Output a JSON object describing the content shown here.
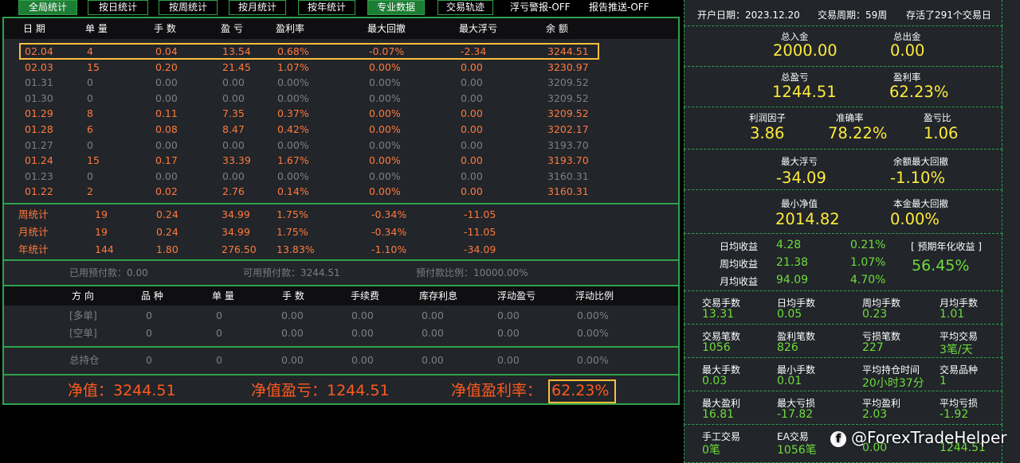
{
  "tabs": [
    {
      "label": "全局统计",
      "active": true
    },
    {
      "label": "按日统计",
      "active": false
    },
    {
      "label": "按周统计",
      "active": false
    },
    {
      "label": "按月统计",
      "active": false
    },
    {
      "label": "按年统计",
      "active": false
    },
    {
      "label": "专业数据",
      "active": true
    },
    {
      "label": "交易轨迹",
      "active": false
    }
  ],
  "flags": {
    "float_alert": "浮亏警报-OFF",
    "report_push": "报告推送-OFF"
  },
  "daily": {
    "headers": [
      "日 期",
      "单 量",
      "手 数",
      "盈 亏",
      "盈利率",
      "最大回撤",
      "最大浮亏",
      "余 额"
    ],
    "rows": [
      {
        "date": "02.04",
        "count": "4",
        "lots": "0.04",
        "pnl": "13.54",
        "rate": "0.68%",
        "maxdd": "-0.07%",
        "maxfloat": "-2.34",
        "balance": "3244.51",
        "style": "o"
      },
      {
        "date": "02.03",
        "count": "15",
        "lots": "0.20",
        "pnl": "21.45",
        "rate": "1.07%",
        "maxdd": "0.00%",
        "maxfloat": "0.00",
        "balance": "3230.97",
        "style": "o"
      },
      {
        "date": "01.31",
        "count": "0",
        "lots": "0.00",
        "pnl": "0.00",
        "rate": "0.00%",
        "maxdd": "0.00%",
        "maxfloat": "0.00",
        "balance": "3209.52",
        "style": "g"
      },
      {
        "date": "01.30",
        "count": "0",
        "lots": "0.00",
        "pnl": "0.00",
        "rate": "0.00%",
        "maxdd": "0.00%",
        "maxfloat": "0.00",
        "balance": "3209.52",
        "style": "g"
      },
      {
        "date": "01.29",
        "count": "8",
        "lots": "0.11",
        "pnl": "7.35",
        "rate": "0.37%",
        "maxdd": "0.00%",
        "maxfloat": "0.00",
        "balance": "3209.52",
        "style": "o"
      },
      {
        "date": "01.28",
        "count": "6",
        "lots": "0.08",
        "pnl": "8.47",
        "rate": "0.42%",
        "maxdd": "0.00%",
        "maxfloat": "0.00",
        "balance": "3202.17",
        "style": "o"
      },
      {
        "date": "01.27",
        "count": "0",
        "lots": "0.00",
        "pnl": "0.00",
        "rate": "0.00%",
        "maxdd": "0.00%",
        "maxfloat": "0.00",
        "balance": "3193.70",
        "style": "g"
      },
      {
        "date": "01.24",
        "count": "15",
        "lots": "0.17",
        "pnl": "33.39",
        "rate": "1.67%",
        "maxdd": "0.00%",
        "maxfloat": "0.00",
        "balance": "3193.70",
        "style": "o"
      },
      {
        "date": "01.23",
        "count": "0",
        "lots": "0.00",
        "pnl": "0.00",
        "rate": "0.00%",
        "maxdd": "0.00%",
        "maxfloat": "0.00",
        "balance": "3160.31",
        "style": "g"
      },
      {
        "date": "01.22",
        "count": "2",
        "lots": "0.02",
        "pnl": "2.76",
        "rate": "0.14%",
        "maxdd": "0.00%",
        "maxfloat": "0.00",
        "balance": "3160.31",
        "style": "o"
      }
    ]
  },
  "summary": [
    {
      "label": "周统计",
      "count": "19",
      "lots": "0.24",
      "pnl": "34.99",
      "rate": "1.75%",
      "maxdd": "-0.34%",
      "maxfloat": "-11.05"
    },
    {
      "label": "月统计",
      "count": "19",
      "lots": "0.24",
      "pnl": "34.99",
      "rate": "1.75%",
      "maxdd": "-0.34%",
      "maxfloat": "-11.05"
    },
    {
      "label": "年统计",
      "count": "144",
      "lots": "1.80",
      "pnl": "276.50",
      "rate": "13.83%",
      "maxdd": "-1.10%",
      "maxfloat": "-34.09"
    }
  ],
  "prepay": {
    "used": "已用预付款：0.00",
    "available": "可用预付款：3244.51",
    "ratio": "预付款比例：10000.00%"
  },
  "positions": {
    "headers": [
      "方 向",
      "品 种",
      "单 量",
      "手 数",
      "手续费",
      "库存利息",
      "浮动盈亏",
      "浮动比例"
    ],
    "rows": [
      {
        "dir": "[多单]",
        "symbol": "0",
        "count": "0",
        "lots": "0.00",
        "fee": "0.00",
        "swap": "0.00",
        "floatpnl": "0.00",
        "floatratio": "0.00%"
      },
      {
        "dir": "[空单]",
        "symbol": "0",
        "count": "0",
        "lots": "0.00",
        "fee": "0.00",
        "swap": "0.00",
        "floatpnl": "0.00",
        "floatratio": "0.00%"
      }
    ],
    "total": {
      "dir": "总持仓",
      "symbol": "0",
      "count": "0",
      "lots": "0.00",
      "fee": "0.00",
      "swap": "0.00",
      "floatpnl": "0.00",
      "floatratio": "0.00%"
    }
  },
  "net": {
    "value": "净值：3244.51",
    "pnl": "净值盈亏：1244.51",
    "rate_label": "净值盈利率：",
    "rate": "62.23%"
  },
  "info": {
    "open_date": "开户日期：2023.12.20",
    "cycle": "交易周期：59周",
    "survival": "存活了291个交易日"
  },
  "stats": {
    "deposit_label": "总入金",
    "deposit": "2000.00",
    "withdraw_label": "总出金",
    "withdraw": "0.00",
    "total_pnl_label": "总盈亏",
    "total_pnl": "1244.51",
    "profit_rate_label": "盈利率",
    "profit_rate": "62.23%",
    "pf_label": "利润因子",
    "pf": "3.86",
    "acc_label": "准确率",
    "acc": "78.22%",
    "plr_label": "盈亏比",
    "plr": "1.06",
    "maxfloat_label": "最大浮亏",
    "maxfloat": "-34.09",
    "baldd_label": "余额最大回撤",
    "baldd": "-1.10%",
    "minnet_label": "最小净值",
    "minnet": "2014.82",
    "capdd_label": "本金最大回撤",
    "capdd": "0.00%"
  },
  "returns": {
    "rows": [
      {
        "label": "日均收益",
        "amount": "4.28",
        "pct": "0.21%"
      },
      {
        "label": "周均收益",
        "amount": "21.38",
        "pct": "1.07%"
      },
      {
        "label": "月均收益",
        "amount": "94.09",
        "pct": "4.70%"
      }
    ],
    "annual_label": "[ 预期年化收益 ]",
    "annual": "56.45%"
  },
  "grid": [
    [
      {
        "l": "交易手数",
        "v": "13.31"
      },
      {
        "l": "日均手数",
        "v": "0.05"
      },
      {
        "l": "周均手数",
        "v": "0.23"
      },
      {
        "l": "月均手数",
        "v": "1.01"
      }
    ],
    [
      {
        "l": "交易笔数",
        "v": "1056"
      },
      {
        "l": "盈利笔数",
        "v": "826"
      },
      {
        "l": "亏损笔数",
        "v": "227"
      },
      {
        "l": "平均交易",
        "v": "3笔/天"
      }
    ],
    [
      {
        "l": "最大手数",
        "v": "0.03"
      },
      {
        "l": "最小手数",
        "v": "0.01"
      },
      {
        "l": "平均持仓时间",
        "v": "20小时37分"
      },
      {
        "l": "交易品种",
        "v": "1"
      }
    ],
    [
      {
        "l": "最大盈利",
        "v": "16.81"
      },
      {
        "l": "最大亏损",
        "v": "-17.82"
      },
      {
        "l": "平均盈利",
        "v": "2.03"
      },
      {
        "l": "平均亏损",
        "v": "-1.92"
      }
    ],
    [
      {
        "l": "手工交易",
        "v": "0笔"
      },
      {
        "l": "EA交易",
        "v": "1056笔"
      },
      {
        "l": "",
        "v": "0.00"
      },
      {
        "l": "",
        "v": "1244.51"
      }
    ]
  ],
  "watermark": "@ForexTradeHelper",
  "colors": {
    "green_border": "#2da24a",
    "orange": "#ff7a3d",
    "yellow": "#ffeb3b",
    "lime": "#6fdc3c",
    "highlight": "#ffbe3c"
  }
}
